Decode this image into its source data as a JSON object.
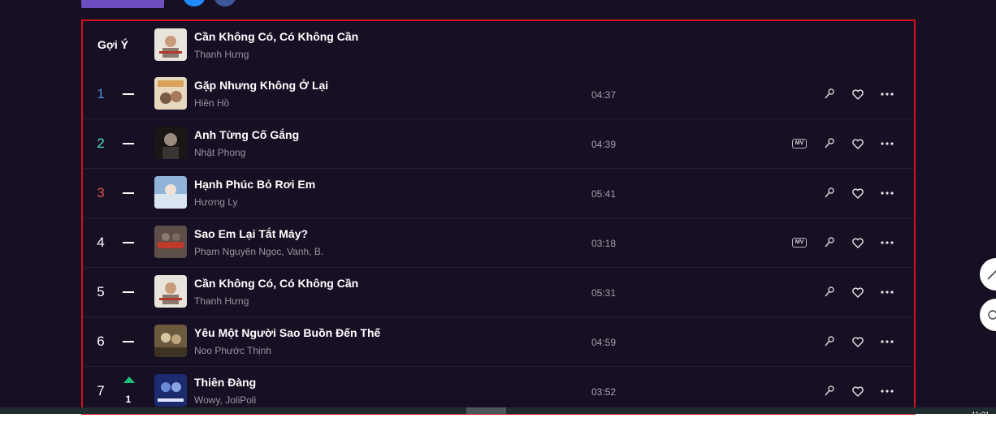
{
  "colors": {
    "background": "#170f23",
    "frame_border": "#d3141b",
    "rank1": "#4a90e2",
    "rank2": "#50e3c2",
    "rank3": "#e35050",
    "trend_up": "#1dc480"
  },
  "suggest": {
    "label": "Gợi Ý",
    "title": "Cần Không Có, Có Không Cần",
    "artist": "Thanh Hưng"
  },
  "songs": [
    {
      "rank": "1",
      "title": "Gặp Nhưng Không Ở Lại",
      "artist": "Hiền Hồ",
      "duration": "04:37",
      "trend": "same",
      "has_mv": false
    },
    {
      "rank": "2",
      "title": "Anh Từng Cố Gắng",
      "artist": "Nhật Phong",
      "duration": "04:39",
      "trend": "same",
      "has_mv": true
    },
    {
      "rank": "3",
      "title": "Hạnh Phúc Bỏ Rơi Em",
      "artist": "Hương Ly",
      "duration": "05:41",
      "trend": "same",
      "has_mv": false
    },
    {
      "rank": "4",
      "title": "Sao Em Lại Tắt Máy?",
      "artist": "Phạm Nguyên Ngọc, Vanh, B.",
      "duration": "03:18",
      "trend": "same",
      "has_mv": true
    },
    {
      "rank": "5",
      "title": "Cần Không Có, Có Không Cần",
      "artist": "Thanh Hưng",
      "duration": "05:31",
      "trend": "same",
      "has_mv": false
    },
    {
      "rank": "6",
      "title": "Yêu Một Người Sao Buồn Đến Thế",
      "artist": "Noo Phước Thịnh",
      "duration": "04:59",
      "trend": "same",
      "has_mv": false
    },
    {
      "rank": "7",
      "title": "Thiên Đàng",
      "artist": "Wowy, JoliPoli",
      "duration": "03:52",
      "trend": "up",
      "trend_value": "1",
      "has_mv": false
    }
  ],
  "icons": {
    "mv": "MV",
    "karaoke": "microphone-icon",
    "favorite": "heart-icon",
    "more": "more-icon"
  },
  "clock": "11:21"
}
